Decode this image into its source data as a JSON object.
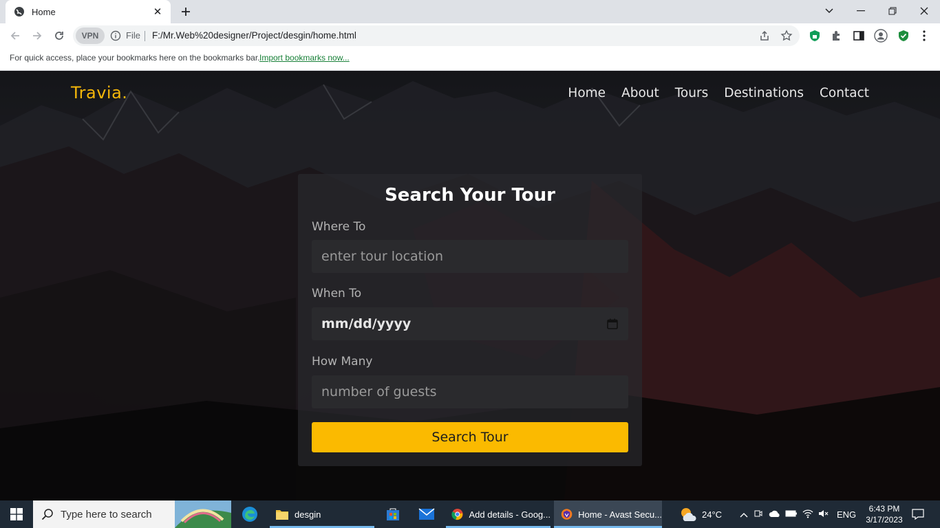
{
  "browser": {
    "tab_title": "Home",
    "new_tab_label": "+",
    "vpn_label": "VPN",
    "file_label": "File",
    "url": "F:/Mr.Web%20designer/Project/desgin/home.html",
    "bookmarks_prompt": "For quick access, place your bookmarks here on the bookmarks bar.",
    "bookmarks_link": "Import bookmarks now..."
  },
  "site": {
    "logo": "Travia.",
    "nav": [
      "Home",
      "About",
      "Tours",
      "Destinations",
      "Contact"
    ]
  },
  "form": {
    "title": "Search Your Tour",
    "where_label": "Where To",
    "where_placeholder": "enter tour location",
    "when_label": "When To",
    "when_value": "mm/dd/yyyy",
    "howmany_label": "How Many",
    "howmany_placeholder": "number of guests",
    "submit_label": "Search Tour"
  },
  "taskbar": {
    "search_placeholder": "Type here to search",
    "apps": [
      {
        "label": "desgin",
        "icon": "folder-icon"
      },
      {
        "label": "Add details - Goog...",
        "icon": "chrome-icon"
      },
      {
        "label": "Home - Avast Secu...",
        "icon": "avast-browser-icon"
      }
    ],
    "weather": "24°C",
    "language": "ENG",
    "time": "6:43 PM",
    "date": "3/17/2023"
  },
  "colors": {
    "accent": "#fbba00",
    "logo": "#f5b70a",
    "taskbar": "#1f2a36"
  }
}
